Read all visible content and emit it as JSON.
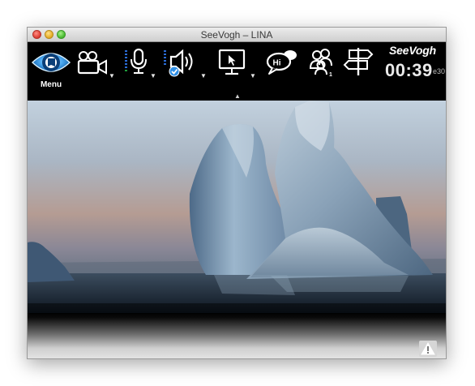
{
  "window": {
    "title": "SeeVogh – LINA"
  },
  "toolbar": {
    "menu_label": "Menu",
    "brand": {
      "see": "See",
      "vogh": "Vogh"
    },
    "timer": "00:39",
    "timer_sub": "e30",
    "icons": [
      "eye-menu-icon",
      "video-camera-icon",
      "microphone-icon",
      "speaker-icon",
      "screen-share-icon",
      "chat-icon",
      "participants-icon",
      "signpost-icon"
    ],
    "colors": {
      "bar": "#000000",
      "accent_blue": "#2f8fe6"
    }
  },
  "status": {
    "warning_icon": "warning-icon"
  }
}
